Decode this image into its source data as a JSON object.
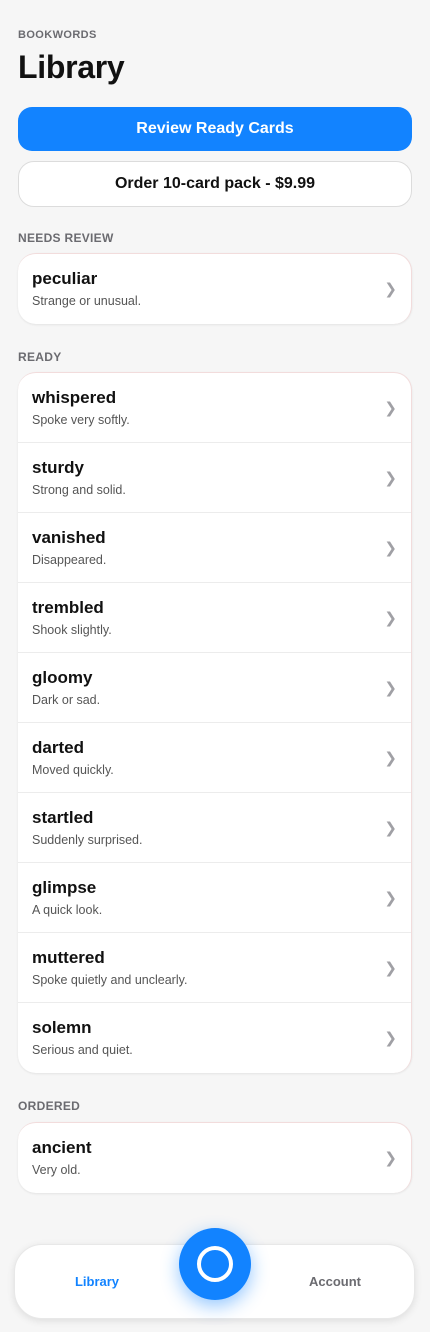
{
  "header": {
    "app_label": "BOOKWORDS",
    "title": "Library"
  },
  "actions": {
    "review_label": "Review Ready Cards",
    "order_label": "Order 10-card pack - $9.99"
  },
  "sections": {
    "needs_review": {
      "title": "NEEDS REVIEW",
      "items": [
        {
          "word": "peculiar",
          "definition": "Strange or unusual."
        }
      ]
    },
    "ready": {
      "title": "READY",
      "items": [
        {
          "word": "whispered",
          "definition": "Spoke very softly."
        },
        {
          "word": "sturdy",
          "definition": "Strong and solid."
        },
        {
          "word": "vanished",
          "definition": "Disappeared."
        },
        {
          "word": "trembled",
          "definition": "Shook slightly."
        },
        {
          "word": "gloomy",
          "definition": "Dark or sad."
        },
        {
          "word": "darted",
          "definition": "Moved quickly."
        },
        {
          "word": "startled",
          "definition": "Suddenly surprised."
        },
        {
          "word": "glimpse",
          "definition": "A quick look."
        },
        {
          "word": "muttered",
          "definition": "Spoke quietly and unclearly."
        },
        {
          "word": "solemn",
          "definition": "Serious and quiet."
        }
      ]
    },
    "ordered": {
      "title": "ORDERED",
      "items": [
        {
          "word": "ancient",
          "definition": "Very old."
        }
      ]
    }
  },
  "chevron_glyph": "❯",
  "tab_bar": {
    "library_label": "Library",
    "account_label": "Account",
    "center_button_icon": "circle-ring-icon"
  },
  "colors": {
    "accent": "#1283ff",
    "background": "#f6f6f6",
    "muted_text": "#6b6b70"
  }
}
